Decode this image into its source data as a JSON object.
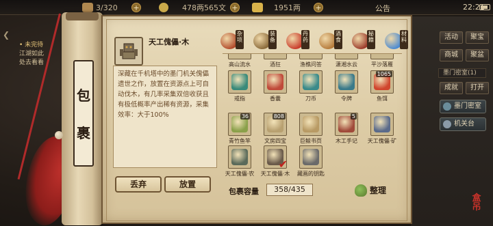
{
  "topbar": {
    "stamina": "3/320",
    "copper": "478两565文",
    "gold": "1951两",
    "announce": "公告",
    "time": "22:21"
  },
  "quest": {
    "title": "• 未完待",
    "line1": "江湖如此",
    "line2": "处去看看"
  },
  "side_buttons": {
    "b1": "活动",
    "b2": "聚宝",
    "b3": "商城",
    "b4": "聚盆",
    "b5": "成就",
    "b6": "打开",
    "mini": "墨门密室(1)",
    "wide1": "墨门密室",
    "wide2": "机关台"
  },
  "bag": {
    "title_char_1": "包",
    "title_char_2": "裹",
    "selected_name": "天工傀儡·木",
    "selected_desc": "深藏在千机塔中的墨门机关傀儡遗世之作，放置在资源点上可自动伐木，有几率采集双倍收获且有极低概率产出稀有资源，采集效率：大于100%",
    "discard_label": "丢弃",
    "place_label": "放置",
    "capacity_label": "包裹容量",
    "capacity_value": "358/435",
    "sort_label": "整理"
  },
  "categories": [
    {
      "label": "杂项",
      "icon": "pouch-icon",
      "color": "#b24a2a"
    },
    {
      "label": "装备",
      "icon": "weapon-icon",
      "color": "#8a6a3a"
    },
    {
      "label": "丹药",
      "icon": "pill-icon",
      "color": "#c83a2a"
    },
    {
      "label": "酒食",
      "icon": "wine-jar-icon",
      "color": "#b57a3a"
    },
    {
      "label": "秘籍",
      "icon": "book-icon",
      "color": "#9b3a2a"
    },
    {
      "label": "材料",
      "icon": "crystal-icon",
      "color": "#4a8ad2"
    }
  ],
  "top_row_labels": [
    "高山流水",
    "酒狂",
    "渔樵问答",
    "潇湘水云",
    "平沙落雁"
  ],
  "items": [
    {
      "name": "戒指",
      "qty": "",
      "color": "#3a8a7a",
      "icon": "ring-icon"
    },
    {
      "name": "香囊",
      "qty": "",
      "color": "#c04a3a",
      "icon": "sachet-icon"
    },
    {
      "name": "刀币",
      "qty": "",
      "color": "#3a8a8a",
      "icon": "knife-coin-icon"
    },
    {
      "name": "令牌",
      "qty": "",
      "color": "#3a7a8a",
      "icon": "token-icon"
    },
    {
      "name": "鱼饵",
      "qty": "1065",
      "color": "#d0462e",
      "icon": "bait-worm-icon"
    },
    {
      "name": "青竹鱼竿",
      "qty": "36",
      "color": "#8aa04a",
      "icon": "fishing-rod-icon"
    },
    {
      "name": "文房四宝",
      "qty": "808",
      "color": "#b8a070",
      "icon": "calligraphy-set-icon"
    },
    {
      "name": "巨鲸书页",
      "qty": "",
      "color": "#b89a64",
      "icon": "scroll-page-icon"
    },
    {
      "name": "木工手记",
      "qty": "5",
      "color": "#a04a3a",
      "icon": "notebook-icon"
    },
    {
      "name": "天工傀儡·矿",
      "qty": "",
      "color": "#5a6a8a",
      "icon": "puppet-mine-icon"
    },
    {
      "name": "天工傀儡·农",
      "qty": "",
      "color": "#5a6a5a",
      "icon": "puppet-farm-icon"
    },
    {
      "name": "天工傀儡·木",
      "qty": "",
      "color": "#6a5a4a",
      "icon": "puppet-wood-icon",
      "selected": true
    },
    {
      "name": "藏画的钥匙",
      "qty": "",
      "color": "#6a6a6a",
      "icon": "key-icon"
    }
  ]
}
